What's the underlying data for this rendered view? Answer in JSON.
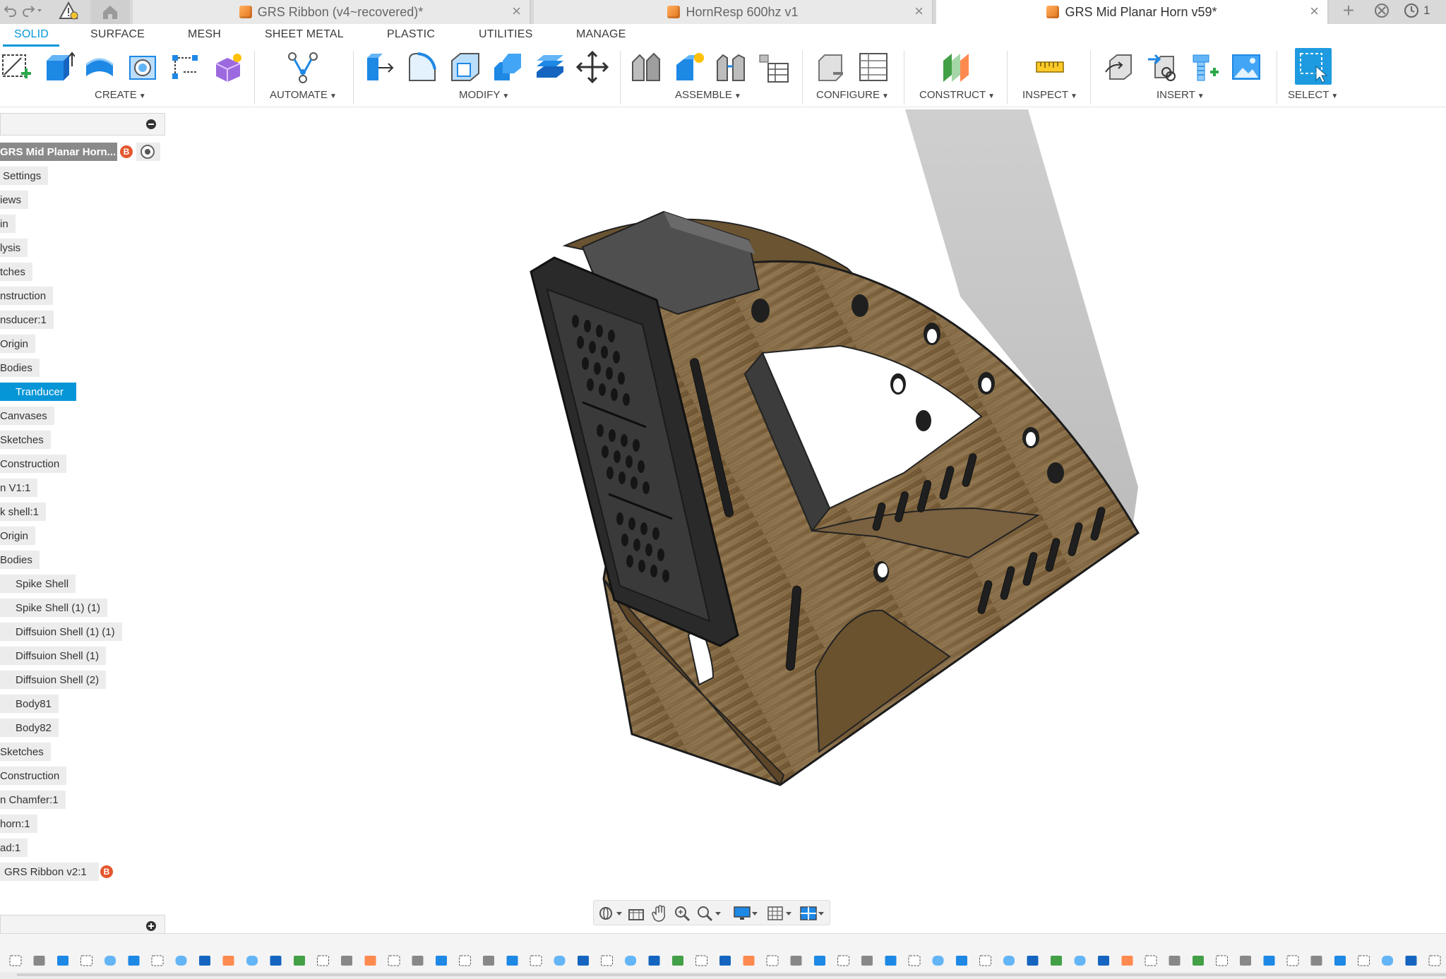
{
  "tabs": {
    "documents": [
      {
        "label": "GRS Ribbon (v4~recovered)*",
        "active": false
      },
      {
        "label": "HornResp 600hz v1",
        "active": false
      },
      {
        "label": "GRS Mid Planar Horn v59*",
        "active": true
      }
    ],
    "close_glyph": "×",
    "new_tab_glyph": "+",
    "job_count": "1"
  },
  "workspace_tabs": [
    "SOLID",
    "SURFACE",
    "MESH",
    "SHEET METAL",
    "PLASTIC",
    "UTILITIES",
    "MANAGE"
  ],
  "toolbar_groups": {
    "create": "CREATE",
    "automate": "AUTOMATE",
    "modify": "MODIFY",
    "assemble": "ASSEMBLE",
    "configure": "CONFIGURE",
    "construct": "CONSTRUCT",
    "inspect": "INSPECT",
    "insert": "INSERT",
    "select": "SELECT"
  },
  "browser": {
    "root": "GRS Mid Planar Horn...",
    "badge": "B",
    "items": [
      "Settings",
      "iews",
      "in",
      "lysis",
      "tches",
      "nstruction",
      "nsducer:1",
      "Origin",
      "Bodies",
      "Tranducer",
      "Canvases",
      "Sketches",
      "Construction",
      "n V1:1",
      "k shell:1",
      "Origin",
      "Bodies",
      "Spike Shell",
      "Spike Shell (1) (1)",
      "Diffsuion Shell (1) (1)",
      "Diffsuion Shell (1)",
      "Diffsuion Shell (2)",
      "Body81",
      "Body82",
      "Sketches",
      "Construction",
      "n Chamfer:1",
      "horn:1",
      "ad:1",
      "GRS Ribbon v2:1"
    ]
  },
  "colors": {
    "accent": "#0696d7",
    "wood": "#8a6e45",
    "wood_dark": "#6e5532",
    "driver_black": "#2b2b2b",
    "magnet_gray": "#555555",
    "shadow": "#c9c9c9",
    "badge": "#e4572e"
  },
  "icons": {
    "home": "home-icon",
    "warning": "warning-icon",
    "undo": "undo-icon",
    "redo": "redo-icon",
    "jobs": "job-status-icon",
    "orbit": "orbit-icon",
    "look_at": "look-at-icon",
    "pan": "pan-icon",
    "zoom": "zoom-icon",
    "fit": "zoom-window-icon",
    "display": "display-settings-icon",
    "grid": "grid-settings-icon",
    "viewports": "viewports-icon"
  }
}
